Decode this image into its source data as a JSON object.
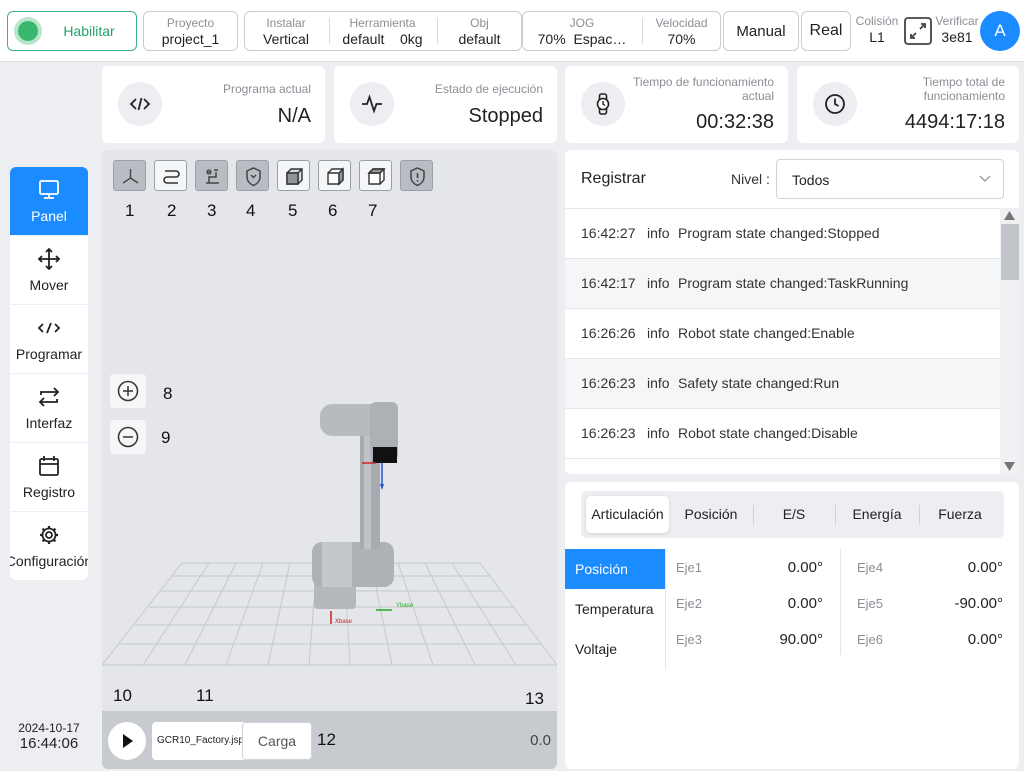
{
  "topbar": {
    "enable_label": "Habilitar",
    "project": {
      "title": "Proyecto",
      "value": "project_1"
    },
    "install": {
      "title": "Instalar",
      "value": "Vertical"
    },
    "tool": {
      "title": "Herramienta",
      "value": "default",
      "load": "0kg"
    },
    "obj": {
      "title": "Obj",
      "value": "default"
    },
    "jog": {
      "title": "JOG",
      "value": "70%",
      "space": "Espac…"
    },
    "speed": {
      "title": "Velocidad",
      "value": "70%"
    },
    "mode_label": "Manual",
    "real_label": "Real",
    "collision": {
      "title": "Colisión",
      "value": "L1"
    },
    "verify": {
      "title": "Verificar",
      "value": "3e81"
    },
    "avatar_letter": "A"
  },
  "sidebar": {
    "items": [
      {
        "label": "Panel",
        "icon": "monitor-icon"
      },
      {
        "label": "Mover",
        "icon": "move-icon"
      },
      {
        "label": "Programar",
        "icon": "code-icon"
      },
      {
        "label": "Interfaz",
        "icon": "swap-icon"
      },
      {
        "label": "Registro",
        "icon": "calendar-icon"
      },
      {
        "label": "Configuración",
        "icon": "gear-icon"
      }
    ],
    "date": "2024-10-17",
    "time": "16:44:06"
  },
  "cards": {
    "program": {
      "title": "Programa actual",
      "value": "N/A"
    },
    "exec": {
      "title": "Estado de ejecución",
      "value": "Stopped"
    },
    "runtime": {
      "title": "Tiempo de funcionamiento actual",
      "value": "00:32:38"
    },
    "total": {
      "title": "Tiempo total de funcionamiento",
      "value": "4494:17:18"
    }
  },
  "viewer": {
    "labels": [
      "1",
      "2",
      "3",
      "4",
      "5",
      "6",
      "7",
      "8",
      "9",
      "10",
      "11",
      "12",
      "13"
    ],
    "axis_labels": {
      "x": "Xbase",
      "y": "Ybase"
    },
    "file": "GCR10_Factory.jspf",
    "load_label": "Carga",
    "progress": "0.0"
  },
  "log": {
    "title": "Registrar",
    "level_label": "Nivel :",
    "level_value": "Todos",
    "rows": [
      {
        "time": "16:42:27",
        "level": "info",
        "msg": "Program state changed:Stopped"
      },
      {
        "time": "16:42:17",
        "level": "info",
        "msg": "Program state changed:TaskRunning"
      },
      {
        "time": "16:26:26",
        "level": "info",
        "msg": "Robot state changed:Enable"
      },
      {
        "time": "16:26:23",
        "level": "info",
        "msg": "Safety state changed:Run"
      },
      {
        "time": "16:26:23",
        "level": "info",
        "msg": "Robot state changed:Disable"
      }
    ]
  },
  "joints": {
    "tabs": [
      "Articulación",
      "Posición",
      "E/S",
      "Energía",
      "Fuerza"
    ],
    "subtabs": [
      "Posición",
      "Temperatura",
      "Voltaje"
    ],
    "values": [
      {
        "name": "Eje1",
        "value": "0.00°"
      },
      {
        "name": "Eje2",
        "value": "0.00°"
      },
      {
        "name": "Eje3",
        "value": "90.00°"
      },
      {
        "name": "Eje4",
        "value": "0.00°"
      },
      {
        "name": "Eje5",
        "value": "-90.00°"
      },
      {
        "name": "Eje6",
        "value": "0.00°"
      }
    ]
  },
  "colors": {
    "accent": "#1a8cff",
    "enable": "#26a06a"
  }
}
